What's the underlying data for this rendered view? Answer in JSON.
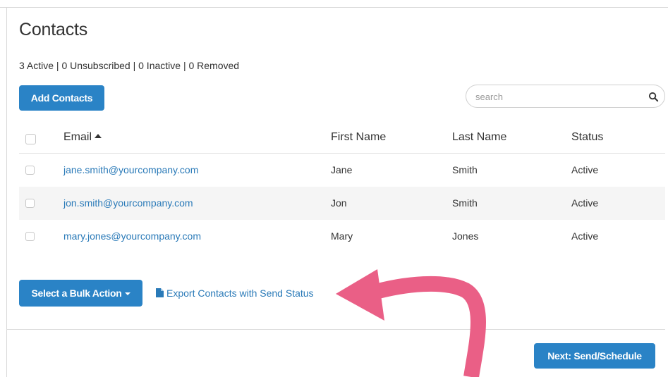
{
  "page": {
    "title": "Contacts",
    "counts": "3 Active | 0 Unsubscribed | 0 Inactive | 0 Removed"
  },
  "toolbar": {
    "add_label": "Add Contacts",
    "search_placeholder": "search"
  },
  "table": {
    "headers": {
      "email": "Email",
      "first": "First Name",
      "last": "Last Name",
      "status": "Status"
    },
    "sort": "Email ascending",
    "rows": [
      {
        "email": "jane.smith@yourcompany.com",
        "first": "Jane",
        "last": "Smith",
        "status": "Active"
      },
      {
        "email": "jon.smith@yourcompany.com",
        "first": "Jon",
        "last": "Smith",
        "status": "Active"
      },
      {
        "email": "mary.jones@yourcompany.com",
        "first": "Mary",
        "last": "Jones",
        "status": "Active"
      }
    ]
  },
  "actions": {
    "bulk_label": "Select a Bulk Action",
    "export_label": "Export Contacts with Send Status",
    "next_label": "Next: Send/Schedule"
  },
  "colors": {
    "primary": "#2a83c6",
    "link": "#2a7ab8",
    "annotation_arrow": "#ea5f86",
    "row_alt": "#f5f5f5"
  },
  "icons": {
    "search": "magnifier-icon",
    "sort": "sort-ascending-icon",
    "bulk_caret": "caret-down-icon",
    "export": "document-icon"
  }
}
